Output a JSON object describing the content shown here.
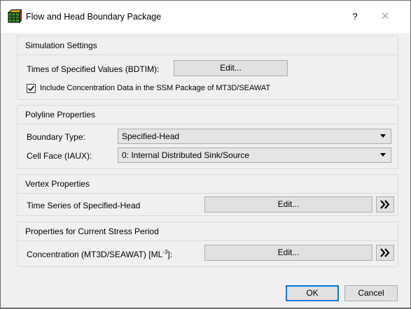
{
  "window": {
    "title": "Flow and Head Boundary Package",
    "help_label": "?",
    "close_label": "✕"
  },
  "simulation": {
    "title": "Simulation Settings",
    "times_label": "Times of Specified Values (BDTIM):",
    "times_button": "Edit...",
    "include_label": "Include Concentration Data in the SSM Package of MT3D/SEAWAT",
    "include_checked": true
  },
  "polyline": {
    "title": "Polyline Properties",
    "boundary_label": "Boundary Type:",
    "boundary_value": "Specified-Head",
    "cellface_label": "Cell Face (IAUX):",
    "cellface_value": "0: Internal Distributed Sink/Source"
  },
  "vertex": {
    "title": "Vertex Properties",
    "series_label": "Time Series of Specified-Head",
    "series_button": "Edit..."
  },
  "stress": {
    "title": "Properties for Current Stress Period",
    "conc_label_pre": "Concentration (MT3D/SEAWAT) [ML",
    "conc_label_sup": "-3",
    "conc_label_post": "]:",
    "conc_button": "Edit..."
  },
  "footer": {
    "ok_label": "OK",
    "cancel_label": "Cancel"
  }
}
